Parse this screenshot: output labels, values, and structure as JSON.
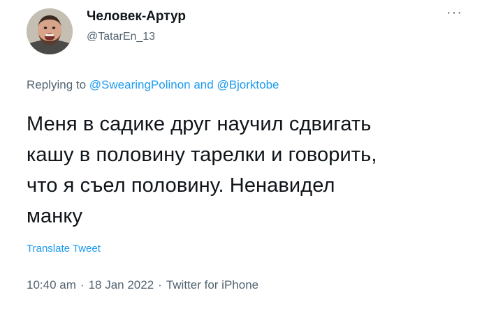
{
  "author": {
    "display_name": "Человек-Артур",
    "handle": "@TatarEn_13"
  },
  "menu": {
    "more_label": "···"
  },
  "reply": {
    "prefix": "Replying to ",
    "mention_1": "@SwearingPolinon",
    "conjunction": " and ",
    "mention_2": "@Bjorktobe"
  },
  "tweet": {
    "line_1": "Меня в садике друг научил сдвигать",
    "line_2": "кашу в половину тарелки и говорить,",
    "line_3": "что я съел половину. Ненавидел",
    "line_4": "манку"
  },
  "translate": {
    "label": "Translate Tweet"
  },
  "meta": {
    "time": "10:40 am",
    "separator": "·",
    "date": "18 Jan 2022",
    "source": "Twitter for iPhone"
  },
  "colors": {
    "text": "#0f1419",
    "secondary": "#536471",
    "link": "#1d9bf0",
    "background": "#ffffff"
  },
  "icons": {
    "more": "more-horizontal-icon",
    "avatar": "avatar"
  }
}
